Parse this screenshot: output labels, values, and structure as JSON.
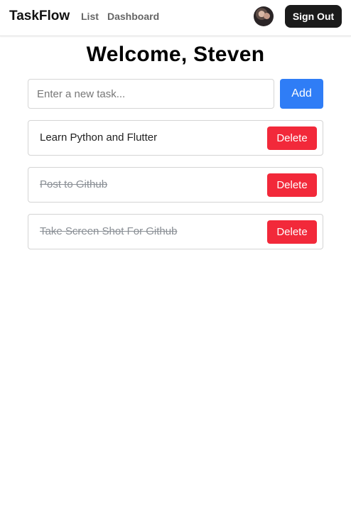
{
  "nav": {
    "brand": "TaskFlow",
    "links": [
      "List",
      "Dashboard"
    ],
    "sign_out_label": "Sign Out"
  },
  "welcome": "Welcome, Steven",
  "new_task": {
    "placeholder": "Enter a new task...",
    "value": "",
    "add_label": "Add"
  },
  "tasks": [
    {
      "text": "Learn Python and Flutter",
      "completed": false,
      "delete_label": "Delete"
    },
    {
      "text": "Post to Github",
      "completed": true,
      "delete_label": "Delete"
    },
    {
      "text": "Take Screen Shot For Github",
      "completed": true,
      "delete_label": "Delete"
    }
  ],
  "colors": {
    "primary": "#2f7df6",
    "danger": "#f2293a",
    "dark": "#1b1b1b"
  }
}
